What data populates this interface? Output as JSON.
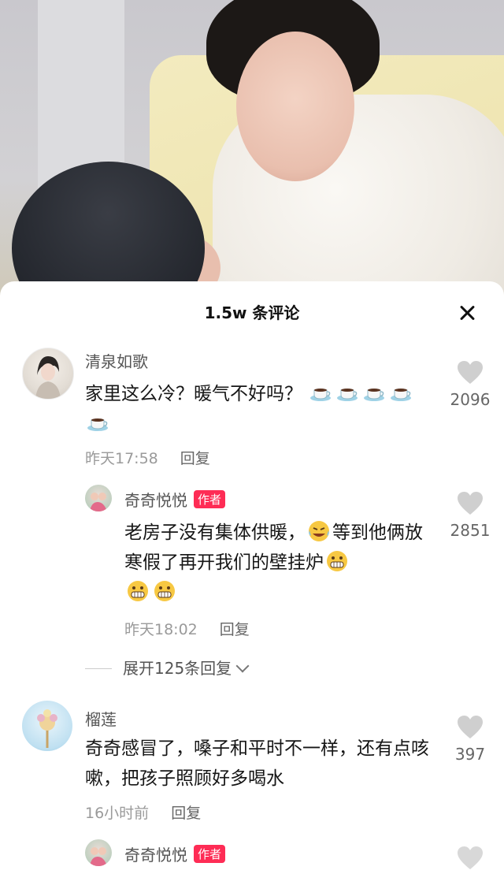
{
  "sheet": {
    "title": "1.5w 条评论"
  },
  "comments": [
    {
      "user": "清泉如歌",
      "text": "家里这么冷？暖气不好吗？",
      "time": "昨天17:58",
      "reply_label": "回复",
      "likes": "2096",
      "emoji_count": 5
    },
    {
      "user": "奇奇悦悦",
      "badge": "作者",
      "text_part1": "老房子没有集体供暖，",
      "text_part2": "等到他俩放寒假了再开我们的壁挂炉",
      "time": "昨天18:02",
      "reply_label": "回复",
      "likes": "2851",
      "expand_label": "展开125条回复"
    },
    {
      "user": "榴莲",
      "text": "奇奇感冒了，嗓子和平时不一样，还有点咳嗽，把孩子照顾好多喝水",
      "time": "16小时前",
      "reply_label": "回复",
      "likes": "397"
    },
    {
      "user": "奇奇悦悦",
      "badge": "作者"
    }
  ],
  "colors": {
    "accent": "#fe2c55",
    "secondary_text": "#9a9a9a",
    "heart": "#cfcfcf"
  }
}
